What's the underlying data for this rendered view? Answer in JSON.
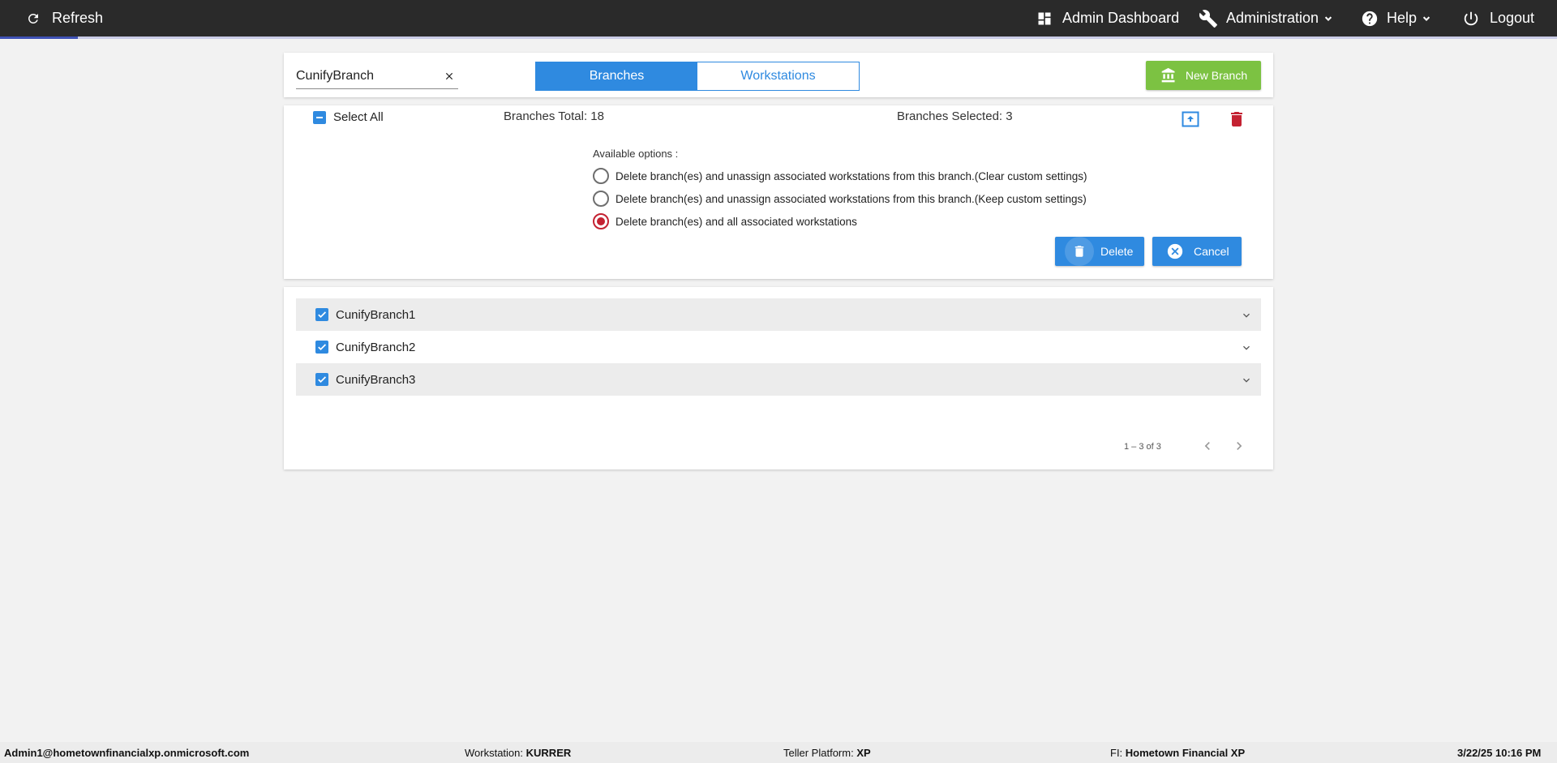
{
  "topbar": {
    "refresh_label": "Refresh",
    "admin_dashboard_label": "Admin Dashboard",
    "administration_label": "Administration",
    "help_label": "Help",
    "logout_label": "Logout",
    "progress": 0.05
  },
  "search": {
    "value": "CunifyBranch"
  },
  "tabs": [
    {
      "label": "Branches",
      "active": true
    },
    {
      "label": "Workstations",
      "active": false
    }
  ],
  "new_branch_label": "New Branch",
  "bulk": {
    "select_all_label": "Select All",
    "branches_total": "Branches Total: 18",
    "branches_selected": "Branches Selected: 3",
    "options_title": "Available options :",
    "options": [
      {
        "label": "Delete branch(es) and unassign associated workstations from this branch.(Clear custom settings)",
        "checked": false
      },
      {
        "label": "Delete branch(es) and unassign associated workstations from this branch.(Keep custom settings)",
        "checked": false
      },
      {
        "label": "Delete branch(es) and all associated workstations",
        "checked": true
      }
    ],
    "delete_label": "Delete",
    "cancel_label": "Cancel"
  },
  "branches": [
    {
      "name": "CunifyBranch1",
      "checked": true
    },
    {
      "name": "CunifyBranch2",
      "checked": true
    },
    {
      "name": "CunifyBranch3",
      "checked": true
    }
  ],
  "pager": {
    "range": "1 – 3 of 3"
  },
  "status": {
    "user": "Admin1@hometownfinancialxp.onmicrosoft.com",
    "workstation_label": "Workstation:",
    "workstation_value": "KURRER",
    "teller_platform_label": "Teller Platform:",
    "teller_platform_value": "XP",
    "fi_label": "FI:",
    "fi_value": "Hometown Financial XP",
    "datetime": "3/22/25 10:16 PM"
  },
  "colors": {
    "accent": "#2f8ae0",
    "success": "#7cc242",
    "danger": "#c42232",
    "topbar": "#2a2a2a"
  },
  "icons": [
    "refresh-icon",
    "dashboard-icon",
    "wrench-icon",
    "help-icon",
    "power-icon",
    "bank-icon",
    "upload-icon",
    "trash-icon",
    "cancel-icon",
    "chevron-down-icon",
    "chevron-left-icon",
    "chevron-right-icon",
    "close-icon"
  ]
}
